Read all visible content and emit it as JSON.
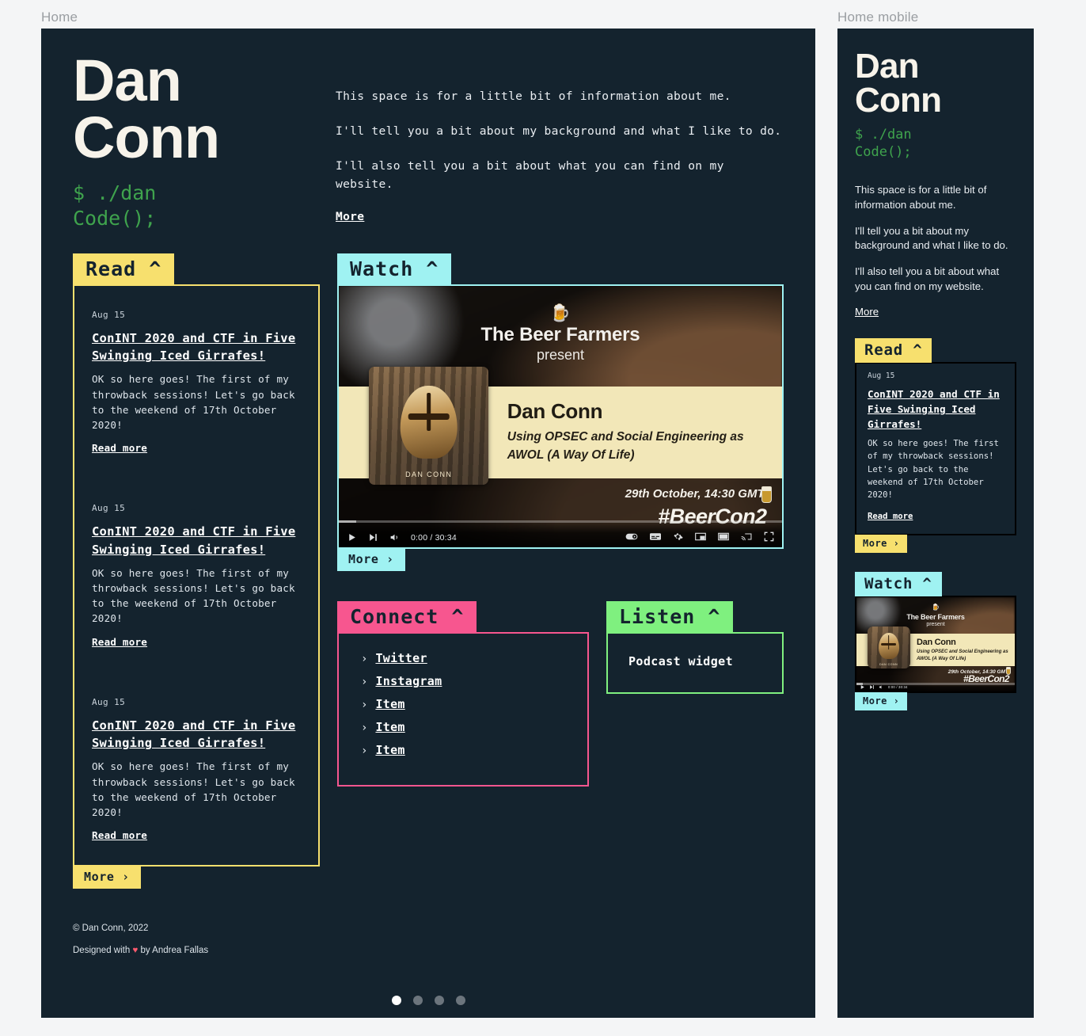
{
  "frames": {
    "desktop_label": "Home",
    "mobile_label": "Home mobile"
  },
  "colors": {
    "page_bg": "#f4f5f6",
    "site_bg": "#14232e",
    "terminal_green": "#3fa34d",
    "read_yellow": "#f7e06e",
    "watch_cyan": "#9ff2f2",
    "connect_pink": "#f7568f",
    "listen_green": "#7ff07f"
  },
  "hero": {
    "name_line1": "Dan",
    "name_line2": "Conn",
    "command": "$ ./dan\nCode();",
    "paragraphs": [
      "This space is for a little bit of information about me.",
      "I'll tell you a bit about my background and what I like to do.",
      "I'll also tell you a bit about what you can find on my website."
    ],
    "more_label": "More"
  },
  "sections": {
    "read": {
      "tab_label": "Read ^",
      "more_label": "More ›",
      "articles": [
        {
          "date": "Aug 15",
          "title": "ConINT 2020 and CTF in Five Swinging Iced Girrafes!",
          "excerpt": "OK so here goes! The first of my throwback sessions! Let's go back to the weekend of 17th October 2020!",
          "read_more": "Read more"
        },
        {
          "date": "Aug 15",
          "title": "ConINT 2020 and CTF in Five Swinging Iced Girrafes!",
          "excerpt": "OK so here goes! The first of my throwback sessions! Let's go back to the weekend of 17th October 2020!",
          "read_more": "Read more"
        },
        {
          "date": "Aug 15",
          "title": "ConINT 2020 and CTF in Five Swinging Iced Girrafes!",
          "excerpt": "OK so here goes! The first of my throwback sessions! Let's go back to the weekend of 17th October 2020!",
          "read_more": "Read more"
        }
      ]
    },
    "watch": {
      "tab_label": "Watch ^",
      "more_label": "More ›",
      "video": {
        "beer_glyph": "🍺",
        "brand": "The Beer Farmers",
        "brand_sub": "present",
        "speaker": "Dan Conn",
        "talk_title": "Using OPSEC and Social Engineering as AWOL (A Way Of Life)",
        "avatar_caption": "DAN CONN",
        "date": "29th October, 14:30 GMT",
        "hashtag": "#BeerCon2",
        "time_display": "0:00 / 30:34",
        "controls": [
          "play-icon",
          "next-icon",
          "volume-icon",
          "autoplay-toggle-icon",
          "subtitles-icon",
          "settings-gear-icon",
          "miniplayer-icon",
          "theater-mode-icon",
          "cast-icon",
          "fullscreen-icon"
        ]
      }
    },
    "connect": {
      "tab_label": "Connect ^",
      "items": [
        "Twitter",
        "Instagram",
        "Item",
        "Item",
        "Item"
      ],
      "caret": "›"
    },
    "listen": {
      "tab_label": "Listen ^",
      "widget_text": "Podcast widget"
    }
  },
  "footer": {
    "copyright": "© Dan Conn, 2022",
    "designed_prefix": "Designed with ",
    "heart": "♥",
    "designed_suffix": " by Andrea Fallas"
  },
  "pagination": {
    "total": 4,
    "active_index": 0
  },
  "mobile": {
    "name_line1": "Dan",
    "name_line2": "Conn",
    "command": "$ ./dan\nCode();",
    "paragraphs": [
      "This space is for a little bit of information about me.",
      "I'll tell you a bit about my background and what I like to do.",
      "I'll also tell you a bit about what you can find on my website."
    ],
    "more_label": "More",
    "read_tab": "Read ^",
    "read_more_btn": "More ›",
    "watch_tab": "Watch ^",
    "watch_more_btn": "More ›",
    "article": {
      "date": "Aug 15",
      "title": "ConINT 2020 and CTF in Five Swinging Iced Girrafes!",
      "excerpt": "OK so here goes! The first of my throwback sessions! Let's go back to the weekend of 17th October 2020!",
      "read_more": "Read more"
    }
  }
}
